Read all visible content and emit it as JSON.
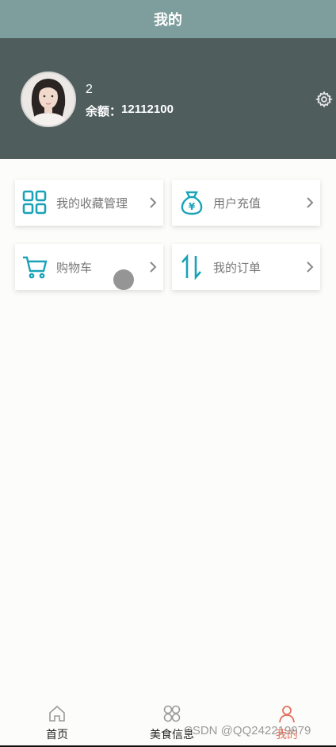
{
  "header": {
    "title": "我的"
  },
  "profile": {
    "username": "2",
    "balance_label": "余额：",
    "balance_value": "12112100"
  },
  "menu": {
    "favorites": "我的收藏管理",
    "recharge": "用户充值",
    "cart": "购物车",
    "orders": "我的订单"
  },
  "tabs": {
    "home": "首页",
    "food": "美食信息",
    "mine": "我的"
  },
  "watermark": "CSDN @QQ242219979",
  "colors": {
    "topbar": "#7d9e9c",
    "profile_bg": "#4f5e5d",
    "icon_teal": "#1aa3b8",
    "active_tab": "#e2715e"
  }
}
